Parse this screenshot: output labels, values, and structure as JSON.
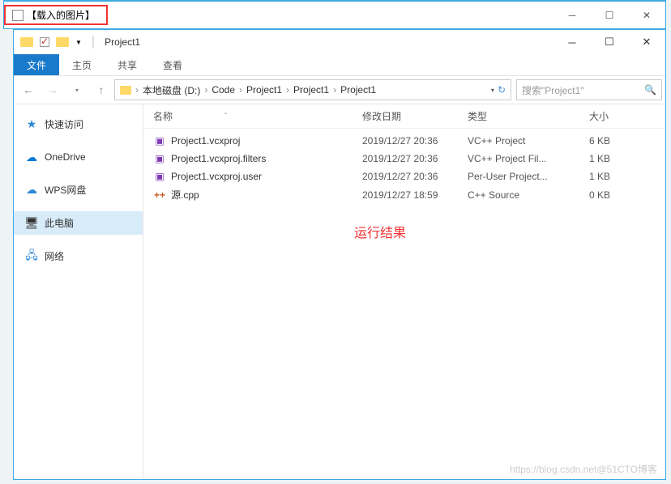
{
  "outer": {
    "title": "【载入的图片】"
  },
  "explorer": {
    "title": "Project1",
    "ribbon": {
      "file": "文件",
      "home": "主页",
      "share": "共享",
      "view": "查看"
    },
    "breadcrumb": [
      "本地磁盘 (D:)",
      "Code",
      "Project1",
      "Project1",
      "Project1"
    ],
    "search_placeholder": "搜索\"Project1\"",
    "sidebar": [
      {
        "label": "快速访问",
        "icon": "★",
        "color": "#2e88d6"
      },
      {
        "label": "OneDrive",
        "icon": "☁",
        "color": "#0078d4"
      },
      {
        "label": "WPS网盘",
        "icon": "☁",
        "color": "#2e88d6"
      },
      {
        "label": "此电脑",
        "icon": "🖥",
        "color": "#555",
        "active": true
      },
      {
        "label": "网络",
        "icon": "🖧",
        "color": "#2e88d6"
      }
    ],
    "columns": {
      "name": "名称",
      "date": "修改日期",
      "type": "类型",
      "size": "大小"
    },
    "files": [
      {
        "name": "Project1.vcxproj",
        "date": "2019/12/27 20:36",
        "type": "VC++ Project",
        "size": "6 KB",
        "ico": "vcx"
      },
      {
        "name": "Project1.vcxproj.filters",
        "date": "2019/12/27 20:36",
        "type": "VC++ Project Fil...",
        "size": "1 KB",
        "ico": "vcx"
      },
      {
        "name": "Project1.vcxproj.user",
        "date": "2019/12/27 20:36",
        "type": "Per-User Project...",
        "size": "1 KB",
        "ico": "vcx"
      },
      {
        "name": "源.cpp",
        "date": "2019/12/27 18:59",
        "type": "C++ Source",
        "size": "0 KB",
        "ico": "cpp"
      }
    ],
    "annotation": "运行结果",
    "watermark": "https://blog.csdn.net@51CTO博客"
  }
}
